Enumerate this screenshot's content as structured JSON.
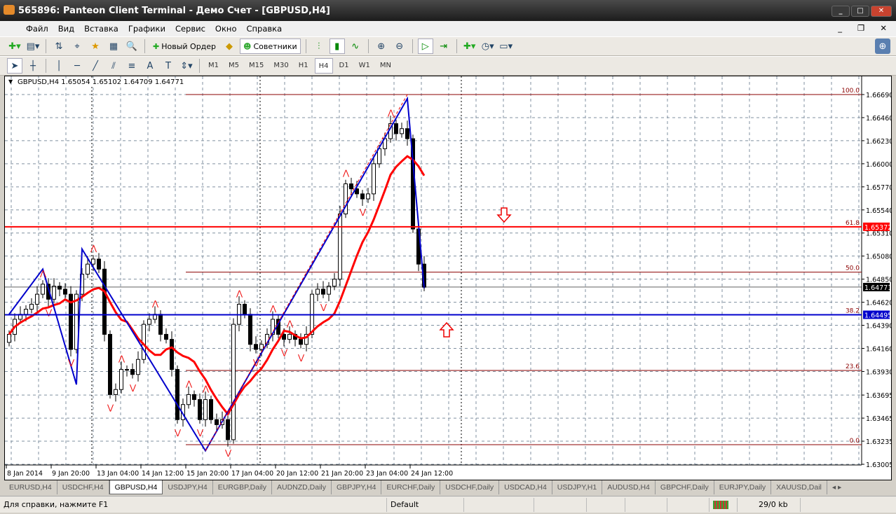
{
  "window": {
    "title": "565896: Panteon Client Terminal - Демо Счет - [GBPUSD,H4]"
  },
  "menu": [
    "Файл",
    "Вид",
    "Вставка",
    "Графики",
    "Сервис",
    "Окно",
    "Справка"
  ],
  "toolbar": {
    "new_order": "Новый Ордер",
    "experts": "Советники"
  },
  "timeframes": [
    "M1",
    "M5",
    "M15",
    "M30",
    "H1",
    "H4",
    "D1",
    "W1",
    "MN"
  ],
  "active_timeframe": "H4",
  "chart": {
    "header": "GBPUSD,H4  1.65054 1.65102 1.64709 1.64771",
    "price_ticks": [
      "1.66690",
      "1.66460",
      "1.66230",
      "1.66000",
      "1.65770",
      "1.65540",
      "1.65310",
      "1.65080",
      "1.64850",
      "1.64620",
      "1.64390",
      "1.64160",
      "1.63930",
      "1.63695",
      "1.63465",
      "1.63235",
      "1.63005"
    ],
    "price_tick_values": [
      1.6669,
      1.6646,
      1.6623,
      1.66,
      1.6577,
      1.6554,
      1.6531,
      1.6508,
      1.6485,
      1.6462,
      1.6439,
      1.6416,
      1.6393,
      1.63695,
      1.63465,
      1.63235,
      1.63005
    ],
    "time_labels": [
      "8 Jan 2014",
      "9 Jan 20:00",
      "13 Jan 04:00",
      "14 Jan 12:00",
      "15 Jan 20:00",
      "17 Jan 04:00",
      "20 Jan 12:00",
      "21 Jan 20:00",
      "23 Jan 04:00",
      "24 Jan 12:00"
    ],
    "closes": [
      1.643,
      1.6445,
      1.645,
      1.6455,
      1.646,
      1.647,
      1.648,
      1.6465,
      1.6478,
      1.6475,
      1.647,
      1.6415,
      1.647,
      1.649,
      1.65,
      1.6505,
      1.6495,
      1.643,
      1.637,
      1.6375,
      1.6395,
      1.6395,
      1.639,
      1.6405,
      1.644,
      1.6445,
      1.645,
      1.643,
      1.6425,
      1.6395,
      1.6345,
      1.636,
      1.637,
      1.6365,
      1.6345,
      1.6365,
      1.6345,
      1.634,
      1.6345,
      1.6325,
      1.644,
      1.646,
      1.645,
      1.642,
      1.6415,
      1.642,
      1.643,
      1.6445,
      1.643,
      1.6425,
      1.643,
      1.6425,
      1.642,
      1.643,
      1.647,
      1.6475,
      1.647,
      1.6478,
      1.6485,
      1.655,
      1.658,
      1.6575,
      1.657,
      1.6565,
      1.657,
      1.66,
      1.6615,
      1.6625,
      1.664,
      1.663,
      1.6635,
      1.6625,
      1.6535,
      1.65,
      1.6477
    ],
    "zigzag": [
      [
        0,
        1.645
      ],
      [
        6,
        1.6495
      ],
      [
        12,
        1.638
      ],
      [
        13,
        1.6515
      ],
      [
        35,
        1.6314
      ],
      [
        71,
        1.6665
      ],
      [
        74,
        1.6476
      ]
    ],
    "fib_levels": [
      {
        "label": "100.0",
        "price": 1.6669
      },
      {
        "label": "61.8",
        "price": 1.65372
      },
      {
        "label": "50.0",
        "price": 1.6492
      },
      {
        "label": "38.2",
        "price": 1.64495
      },
      {
        "label": "23.6",
        "price": 1.6394
      },
      {
        "label": "0.0",
        "price": 1.632
      }
    ],
    "hlines": [
      {
        "label": "1.65372",
        "price": 1.65372,
        "color": "#ff0000"
      },
      {
        "label": "1.64495",
        "price": 1.64495,
        "color": "#0000cc"
      },
      {
        "label": "1.64771",
        "price": 1.64771,
        "color": "#000000"
      }
    ],
    "colors": {
      "ma": "#ff0000",
      "zigzag": "#0000cc",
      "fib": "#8b0000",
      "grid": "#8090a0"
    }
  },
  "symbol_tabs": [
    "EURUSD,H4",
    "USDCHF,H4",
    "GBPUSD,H4",
    "USDJPY,H4",
    "EURGBP,Daily",
    "AUDNZD,Daily",
    "GBPJPY,H4",
    "EURCHF,Daily",
    "USDCHF,Daily",
    "USDCAD,H4",
    "USDJPY,H1",
    "AUDUSD,H4",
    "GBPCHF,Daily",
    "EURJPY,Daily",
    "XAUUSD,Dail"
  ],
  "active_tab": "GBPUSD,H4",
  "status": {
    "help": "Для справки, нажмите F1",
    "profile": "Default",
    "traffic": "29/0 kb"
  }
}
